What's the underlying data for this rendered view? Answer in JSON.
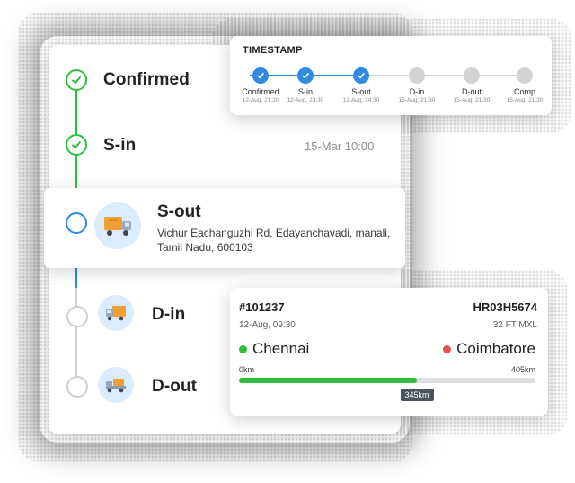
{
  "timeline": {
    "stages": [
      {
        "label": "Confirmed",
        "status": "done",
        "time": ""
      },
      {
        "label": "S-in",
        "status": "done",
        "time": "15-Mar  10:00"
      },
      {
        "label": "S-out",
        "status": "active",
        "address": "Vichur Eachanguzhi Rd, Edayanchavadi, manali, Tamil Nadu, 600103"
      },
      {
        "label": "D-in",
        "status": "pending"
      },
      {
        "label": "D-out",
        "status": "pending"
      }
    ]
  },
  "timestamp": {
    "title": "TIMESTAMP",
    "steps": [
      {
        "name": "Confirmed",
        "date": "12-Aug, 21:30",
        "done": true
      },
      {
        "name": "S-in",
        "date": "12-Aug, 23:30",
        "done": true
      },
      {
        "name": "S-out",
        "date": "12-Aug, 24:30",
        "done": true
      },
      {
        "name": "D-in",
        "date": "15-Aug, 21:30",
        "done": false
      },
      {
        "name": "D-out",
        "date": "15-Aug, 21:30",
        "done": false
      },
      {
        "name": "Comp",
        "date": "15-Aug, 21:30",
        "done": false
      }
    ]
  },
  "trip": {
    "id": "#101237",
    "date": "12-Aug, 09:30",
    "vehicle": "HR03H5674",
    "vehicle_type": "32 FT MXL",
    "origin": "Chennai",
    "destination": "Coimbatore",
    "start_km": "0km",
    "end_km": "405km",
    "current_km": "345km",
    "progress_fraction": 0.6
  },
  "colors": {
    "done": "#2fbf3e",
    "active": "#2f8ae0",
    "pending": "#cfcfcf",
    "origin_dot": "#2fbf3e",
    "destination_dot": "#e5534b"
  }
}
